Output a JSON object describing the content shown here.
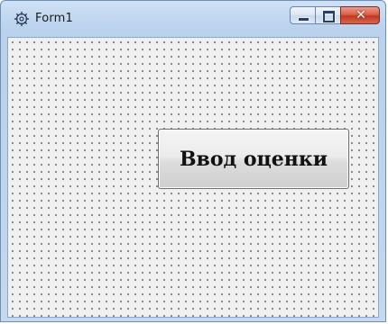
{
  "window": {
    "title": "Form1",
    "icon": "delphi-form-icon",
    "close_symbol": "✕"
  },
  "caption_buttons": {
    "minimize_icon": "minimize-icon",
    "maximize_icon": "maximize-icon",
    "close_icon": "close-icon"
  },
  "form": {
    "grid": "dotted design grid",
    "button_label": "Ввод оценки"
  },
  "colors": {
    "title_bar": "#bcd3ee",
    "close_button": "#c0391f",
    "client_background": "#f0f0f0"
  }
}
